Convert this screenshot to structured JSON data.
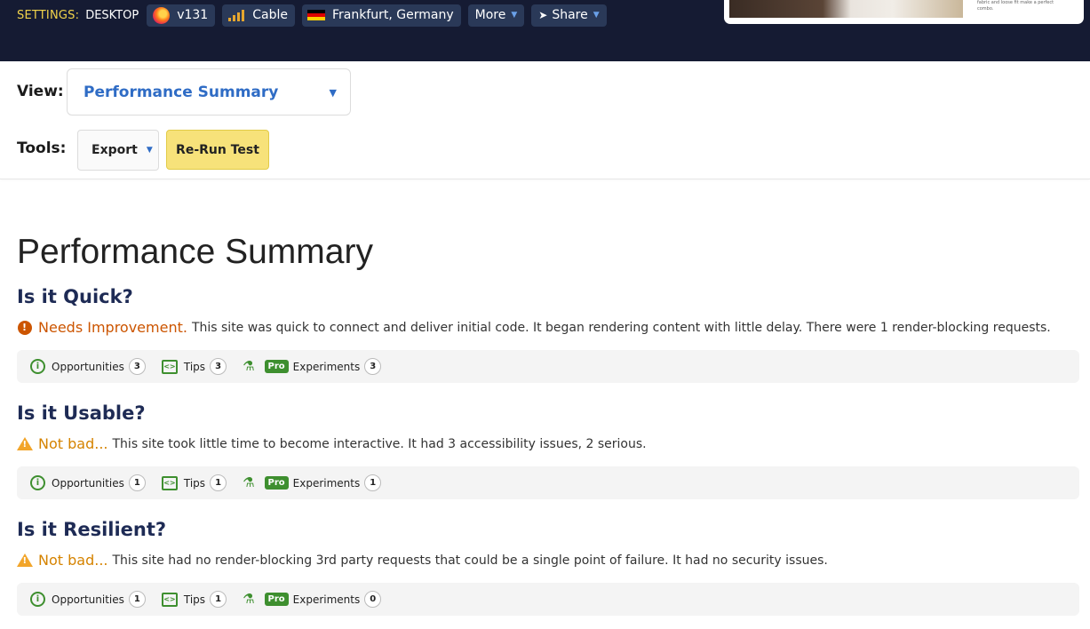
{
  "topbar": {
    "settings_label": "SETTINGS:",
    "device": "DESKTOP",
    "browser": {
      "icon": "firefox-icon",
      "label": "v131"
    },
    "connection": {
      "icon": "signal-bars-icon",
      "label": "Cable"
    },
    "location": {
      "icon": "germany-flag-icon",
      "label": "Frankfurt, Germany"
    },
    "more": {
      "label": "More",
      "icon": "chevron-down-icon"
    },
    "share": {
      "label": "Share",
      "icon": "paper-plane-icon"
    },
    "thumbnail_text": "fabric and loose fit make a perfect combo."
  },
  "controls": {
    "view_label": "View:",
    "view_selected": "Performance Summary",
    "tools_label": "Tools:",
    "export_label": "Export",
    "rerun_label": "Re-Run Test"
  },
  "colors": {
    "topbar_bg": "#151b33",
    "chip_bg": "#2a3958",
    "accent_blue": "#2f6cc5",
    "rerun_bg": "#f7e27a",
    "heading_navy": "#1e2b55",
    "status_orange": "#cc5500",
    "status_amber": "#d58300",
    "green": "#3e8f2f"
  },
  "summary": {
    "title": "Performance Summary",
    "sections": [
      {
        "title": "Is it Quick?",
        "status_icon": "exclamation-circle-icon",
        "status": "Needs Improvement.",
        "description": "This site was quick to connect and deliver initial code. It began rendering content with little delay. There were 1 render-blocking requests.",
        "opportunities_label": "Opportunities",
        "opportunities": "3",
        "tips_label": "Tips",
        "tips": "3",
        "pro_label": "Pro",
        "experiments_label": "Experiments",
        "experiments": "3"
      },
      {
        "title": "Is it Usable?",
        "status_icon": "warning-triangle-icon",
        "status": "Not bad...",
        "description": "This site took little time to become interactive. It had 3 accessibility issues, 2 serious.",
        "opportunities_label": "Opportunities",
        "opportunities": "1",
        "tips_label": "Tips",
        "tips": "1",
        "pro_label": "Pro",
        "experiments_label": "Experiments",
        "experiments": "1"
      },
      {
        "title": "Is it Resilient?",
        "status_icon": "warning-triangle-icon",
        "status": "Not bad...",
        "description": "This site had no render-blocking 3rd party requests that could be a single point of failure. It had no security issues.",
        "opportunities_label": "Opportunities",
        "opportunities": "1",
        "tips_label": "Tips",
        "tips": "1",
        "pro_label": "Pro",
        "experiments_label": "Experiments",
        "experiments": "0"
      }
    ]
  }
}
